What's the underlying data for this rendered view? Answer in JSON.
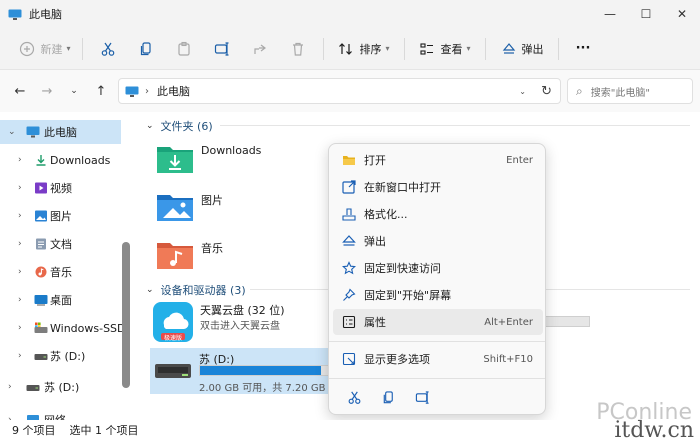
{
  "window": {
    "title": "此电脑"
  },
  "window_controls": {
    "minimize": "—",
    "maximize": "☐",
    "close": "✕"
  },
  "toolbar": {
    "new_label": "新建",
    "sort_label": "排序",
    "view_label": "查看",
    "eject_label": "弹出",
    "more_label": "···"
  },
  "address": {
    "path": "此电脑",
    "search_placeholder": "搜索\"此电脑\""
  },
  "sidebar": {
    "items": [
      {
        "label": "此电脑",
        "expanded": true,
        "selected": true
      },
      {
        "label": "Downloads"
      },
      {
        "label": "视频"
      },
      {
        "label": "图片"
      },
      {
        "label": "文档"
      },
      {
        "label": "音乐"
      },
      {
        "label": "桌面"
      },
      {
        "label": "Windows-SSD"
      },
      {
        "label": "苏 (D:)"
      },
      {
        "label": "苏 (D:)"
      },
      {
        "label": "网络"
      }
    ]
  },
  "content": {
    "folders_group": "文件夹 (6)",
    "folders": [
      "Downloads",
      "图片",
      "音乐"
    ],
    "drives_group": "设备和驱动器 (3)",
    "drives": [
      {
        "name": "天翼云盘 (32 位)",
        "sub": "双击进入天翼云盘",
        "badge": "极速版"
      },
      {
        "name": "苏 (D:)",
        "sub": "2.00 GB 可用，共 7.20 GB",
        "used_fraction": 0.72,
        "selected": true
      }
    ]
  },
  "context_menu": {
    "items": [
      {
        "label": "打开",
        "key": "Enter",
        "icon": "folder-open-icon"
      },
      {
        "label": "在新窗口中打开",
        "key": "",
        "icon": "new-window-icon"
      },
      {
        "label": "格式化...",
        "key": "",
        "icon": "format-icon"
      },
      {
        "label": "弹出",
        "key": "",
        "icon": "eject-icon"
      },
      {
        "label": "固定到快速访问",
        "key": "",
        "icon": "star-icon"
      },
      {
        "label": "固定到\"开始\"屏幕",
        "key": "",
        "icon": "pin-icon"
      },
      {
        "label": "属性",
        "key": "Alt+Enter",
        "icon": "properties-icon"
      },
      {
        "label": "显示更多选项",
        "key": "Shift+F10",
        "icon": "more-options-icon"
      }
    ]
  },
  "status": {
    "count": "9 个项目",
    "selected": "选中 1 个项目"
  },
  "watermark": {
    "brand": "PConline",
    "site": "itdw.cn"
  },
  "colors": {
    "accent": "#1a84d8",
    "selection": "#cce4f7"
  }
}
